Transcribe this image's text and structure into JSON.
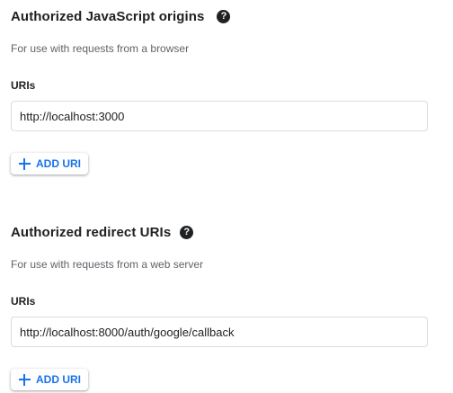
{
  "origins": {
    "title": "Authorized JavaScript origins",
    "help_icon": "help-circle-icon",
    "description": "For use with requests from a browser",
    "uris_label": "URIs",
    "uri_value": "http://localhost:3000",
    "add_button_icon": "plus-icon",
    "add_button_label": "ADD URI"
  },
  "redirects": {
    "title": "Authorized redirect URIs",
    "help_icon": "help-circle-icon",
    "description": "For use with requests from a web server",
    "uris_label": "URIs",
    "uri_value": "http://localhost:8000/auth/google/callback",
    "add_button_icon": "plus-icon",
    "add_button_label": "ADD URI"
  },
  "colors": {
    "accent": "#1a73e8",
    "text": "#202124",
    "secondary_text": "#5f6368",
    "border": "#dadce0"
  }
}
